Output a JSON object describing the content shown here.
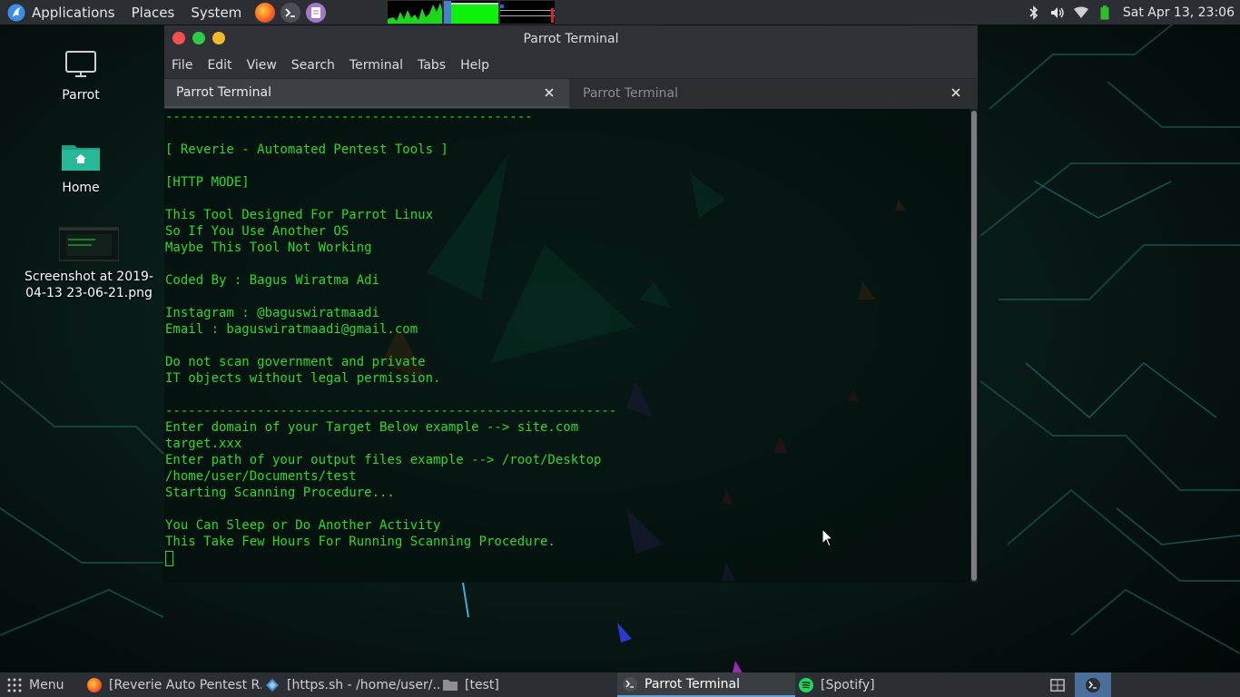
{
  "top_panel": {
    "menus": [
      "Applications",
      "Places",
      "System"
    ],
    "launchers": [
      "firefox-icon",
      "terminal-icon",
      "text-editor-icon"
    ],
    "clock": "Sat Apr 13, 23:06",
    "tray_icons": [
      "bluetooth-icon",
      "volume-icon",
      "wifi-icon",
      "battery-icon"
    ]
  },
  "desktop": {
    "icons": [
      {
        "name": "computer-icon",
        "label": "Parrot"
      },
      {
        "name": "home-folder-icon",
        "label": "Home"
      },
      {
        "name": "screenshot-file-icon",
        "label": "Screenshot at 2019-04-13 23-06-21.png"
      }
    ]
  },
  "window": {
    "title": "Parrot Terminal",
    "menu": [
      "File",
      "Edit",
      "View",
      "Search",
      "Terminal",
      "Tabs",
      "Help"
    ],
    "tabs": [
      {
        "label": "Parrot Terminal",
        "active": true
      },
      {
        "label": "Parrot Terminal",
        "active": false
      }
    ],
    "terminal_lines": [
      "------------------------------------------------",
      "",
      "[ Reverie - Automated Pentest Tools ]",
      "",
      "[HTTP MODE]",
      "",
      "This Tool Designed For Parrot Linux",
      "So If You Use Another OS",
      "Maybe This Tool Not Working",
      "",
      "Coded By : Bagus Wiratma Adi",
      "",
      "Instagram : @baguswiratmaadi",
      "Email : baguswiratmaadi@gmail.com",
      "",
      "Do not scan government and private",
      "IT objects without legal permission.",
      "",
      "-----------------------------------------------------------",
      "Enter domain of your Target Below example --> site.com",
      "target.xxx",
      "Enter path of your output files example --> /root/Desktop",
      "/home/user/Documents/test",
      "Starting Scanning Procedure...",
      "",
      "You Can Sleep or Do Another Activity",
      "This Take Few Hours For Running Scanning Procedure."
    ]
  },
  "taskbar": {
    "menu_label": "Menu",
    "tasks": [
      {
        "icon": "firefox-icon",
        "label": "[Reverie Auto Pentest R...",
        "active": false
      },
      {
        "icon": "editor-icon",
        "label": "[https.sh - /home/user/...",
        "active": false
      },
      {
        "icon": "folder-icon",
        "label": "[test]",
        "active": false
      },
      {
        "icon": "terminal-icon",
        "label": "Parrot Terminal",
        "active": true
      },
      {
        "icon": "spotify-icon",
        "label": "[Spotify]",
        "active": false
      }
    ]
  },
  "colors": {
    "terminal_text": "#2cd82c",
    "panel_bg": "#2b2e33",
    "close_button": "#f2514f",
    "minimize_button": "#2fcb45",
    "maximize_button": "#f4b82b"
  }
}
